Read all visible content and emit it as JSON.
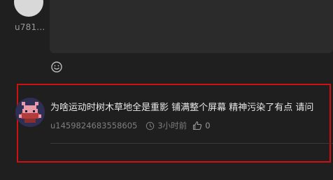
{
  "top_comment": {
    "username": "u781..."
  },
  "comment": {
    "text": "为啥运动时树木草地全是重影 铺满整个屏幕 精神污染了有点 请问",
    "author": "u1459824683558605",
    "time": "3小时前",
    "likes": "0"
  },
  "colors": {
    "background": "#1f1f1f",
    "input_bg": "#2b2b2b",
    "highlight_border": "#cc1111",
    "meta_text": "#7e7e7e"
  },
  "icons": {
    "emoji": "emoji-icon",
    "clock": "clock-icon",
    "like": "thumbs-up-icon"
  }
}
